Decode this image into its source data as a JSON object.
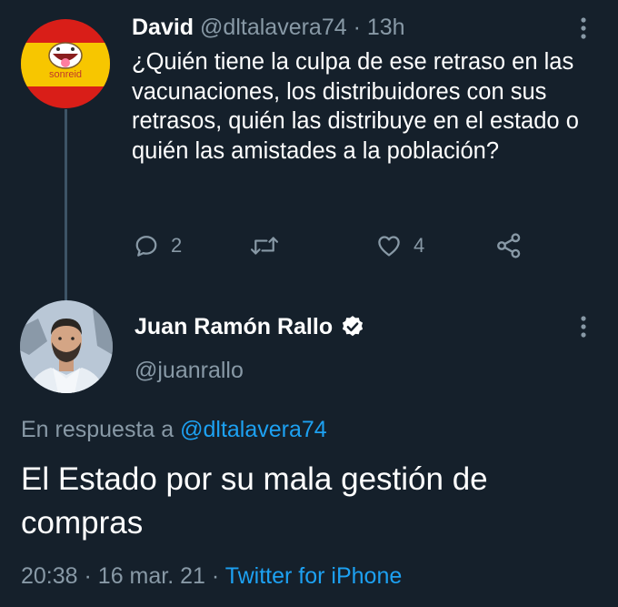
{
  "reply_tweet": {
    "avatar_text": "sonreid",
    "author_name": "David",
    "author_handle": "@dltalavera74",
    "separator": "·",
    "time": "13h",
    "text": "¿Quién tiene la culpa de ese retraso en las vacunaciones, los distribuidores con sus retrasos, quién las distribuye en el estado o quién las amistades a la población?",
    "actions": {
      "reply_count": "2",
      "retweet_count": "",
      "like_count": "4"
    }
  },
  "main_tweet": {
    "author_name": "Juan Ramón Rallo",
    "author_handle": "@juanrallo",
    "reply_prefix": "En respuesta a",
    "reply_mention": "@dltalavera74",
    "text": "El Estado por su mala gestión de compras",
    "time": "20:38",
    "separator1": "·",
    "date": "16 mar. 21",
    "separator2": "·",
    "source": "Twitter for iPhone"
  },
  "colors": {
    "background": "#15202b",
    "secondary_text": "#8899a6",
    "accent": "#1da1f2",
    "verified_badge": "#ffffff"
  }
}
